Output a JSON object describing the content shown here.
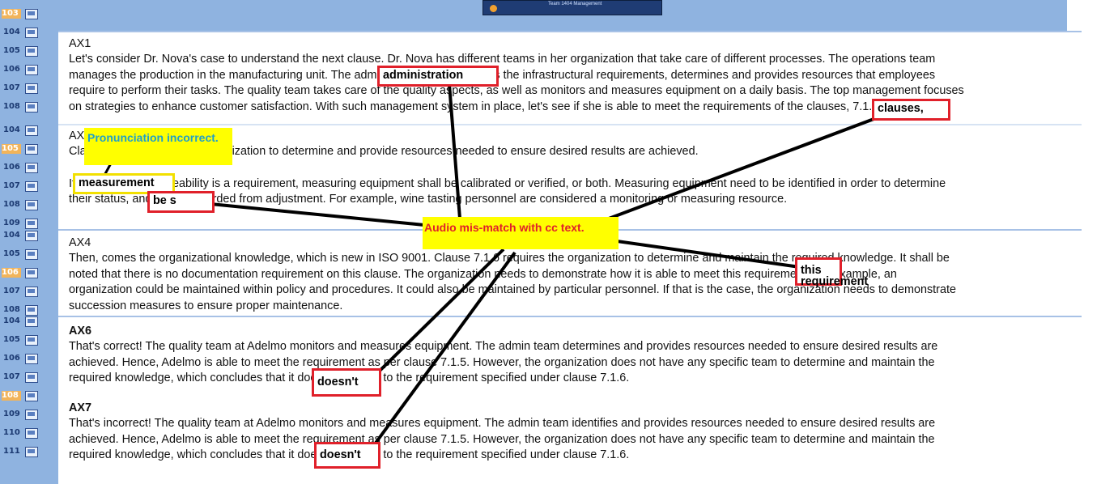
{
  "slide_list": {
    "group1": [
      "103",
      "104",
      "105",
      "106",
      "107",
      "108"
    ],
    "group2": [
      "104",
      "105",
      "106",
      "107",
      "108",
      "109"
    ],
    "group3": [
      "104",
      "105",
      "106",
      "107",
      "108"
    ],
    "group4": [
      "104",
      "105",
      "106",
      "107",
      "108",
      "109",
      "110",
      "111"
    ]
  },
  "player": {
    "label": "Team   1404   Management"
  },
  "blocks": {
    "ax1": {
      "heading": "AX1",
      "lines": [
        "Let's consider Dr. Nova's case to understand the next clause. Dr. Nova has different teams in her organization that take care of different processes. The operations team",
        "manages the production in the manufacturing unit. The administration team handles the infrastructural requirements, determines and provides resources that employees",
        "require to perform their tasks. The quality team takes care of the quality aspects, as well as monitors and measures equipment on a daily basis. The top management focuses",
        "on strategies to enhance customer satisfaction. With such management system in place, let's see if she is able to meet the requirements of the clauses, 7.1.5 and 7.1.6."
      ]
    },
    "ax3": {
      "heading": "AX3",
      "line1": "Clause 7.1.5 requires the organization to determine and provide resources needed to ensure desired results are achieved.",
      "line2": "If measurement traceability is a requirement, measuring equipment shall be calibrated or verified, or both. Measuring equipment need to be identified in order to determine",
      "line3": "their status, and be safeguarded from adjustment. For example, wine tasting personnel are considered a monitoring or measuring resource."
    },
    "ax4": {
      "heading": "AX4",
      "lines": [
        "Then, comes the organizational knowledge, which is new in ISO 9001. Clause 7.1.6 requires the organization to determine and maintain the required knowledge. It shall be",
        "noted that there is no documentation requirement on this clause. The organization needs to demonstrate how it is able to meet this requirement. For example, an",
        "organization could be maintained within policy and procedures. It could also be maintained by particular personnel. If that is the case, the organization needs to demonstrate",
        "succession measures to ensure proper maintenance."
      ]
    },
    "ax6": {
      "heading": "AX6",
      "lines": [
        "That's correct! The quality team at Adelmo monitors and measures equipment. The admin team determines and provides resources needed to ensure desired results are",
        "achieved. Hence, Adelmo is able to meet the requirement as per clause 7.1.5. However, the organization does not have any specific team to determine and maintain the",
        "required knowledge, which concludes that it doesn't conform to the requirement specified under clause 7.1.6."
      ]
    },
    "ax7": {
      "heading": "AX7",
      "lines": [
        "That's incorrect! The quality team at Adelmo monitors and measures equipment. The admin team identifies and provides resources needed to ensure desired results are",
        "achieved. Hence, Adelmo is able to meet the requirement as per clause 7.1.5. However, the organization does not have any specific team to determine and maintain the",
        "required knowledge, which concludes that it doesn't conform to the requirement specified under clause 7.1.6."
      ]
    }
  },
  "annotations": {
    "center_label": "Audio mis-match with cc text.",
    "pronunciation_label": "Pronunciation incorrect.",
    "boxes": {
      "administration": "administration",
      "clauses": "clauses,",
      "measurement": "measurement",
      "be_s": "be s",
      "this_requirement": "this requirement",
      "doesnt1": "doesn't",
      "doesnt2": "doesn't"
    }
  },
  "colors": {
    "annotation_red": "#e0202a",
    "highlight_yellow": "#ffff00",
    "center_text": "#e0202a",
    "pron_text": "#1fa0c8",
    "sidebar": "#8fb3e0"
  }
}
